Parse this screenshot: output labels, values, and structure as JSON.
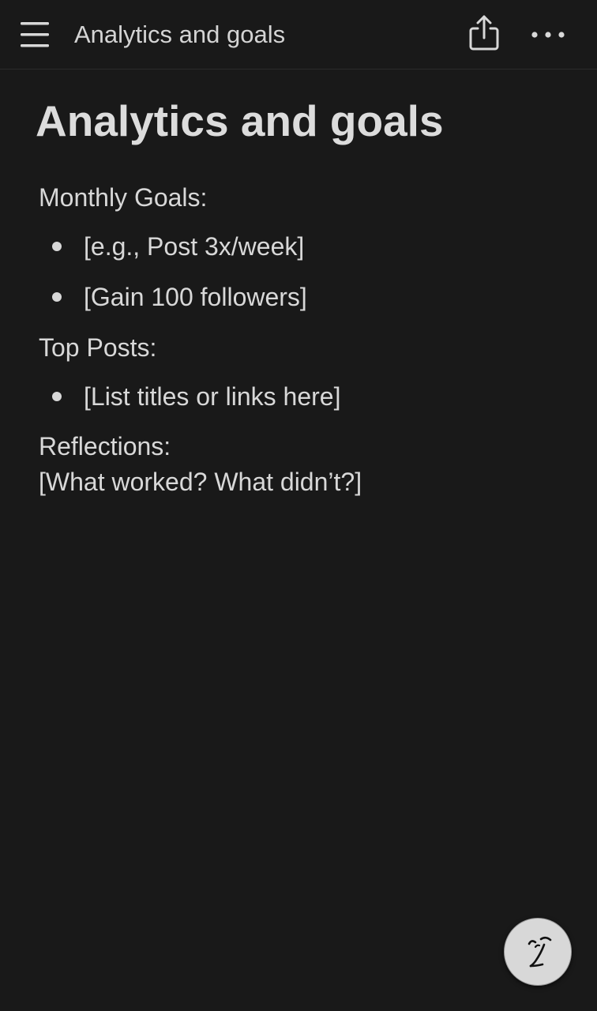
{
  "header": {
    "title": "Analytics and goals",
    "menu_icon": "hamburger-menu-icon",
    "share_icon": "share-icon",
    "more_icon": "more-dots-icon"
  },
  "page": {
    "title": "Analytics and goals",
    "sections": [
      {
        "heading": "Monthly Goals:",
        "bullets": [
          "[e.g., Post 3x/week]",
          "[Gain 100 followers]"
        ]
      },
      {
        "heading": "Top Posts:",
        "bullets": [
          "[List titles or links here]"
        ]
      },
      {
        "heading": "Reflections:",
        "text": "[What worked? What didn’t?]"
      }
    ]
  },
  "fab": {
    "icon": "ai-assistant-face-icon"
  },
  "colors": {
    "background": "#191919",
    "text": "#d8d8d8",
    "fab_background": "#d8d8d8"
  }
}
